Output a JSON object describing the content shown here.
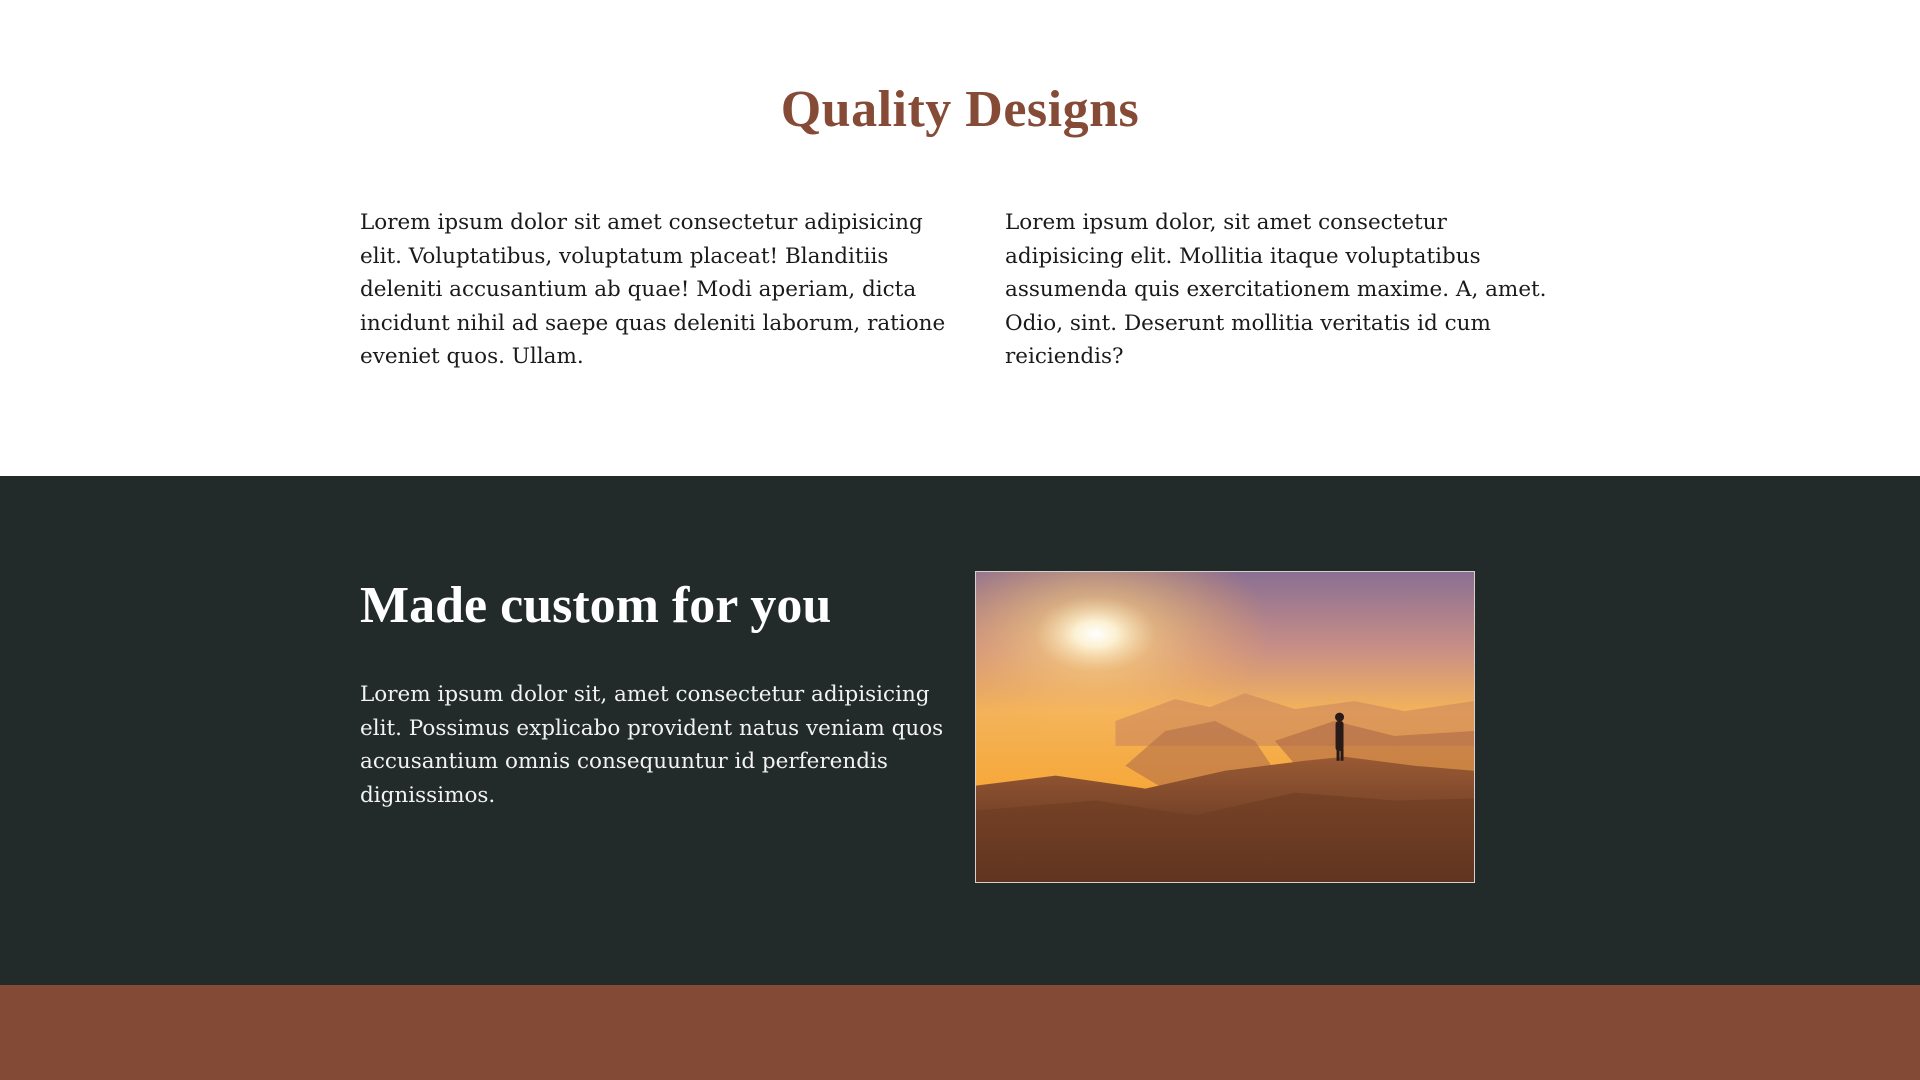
{
  "quality": {
    "title": "Quality Designs",
    "paragraph_left": "Lorem ipsum dolor sit amet consectetur adipisicing elit. Voluptatibus, voluptatum placeat! Blanditiis deleniti accusantium ab quae! Modi aperiam, dicta incidunt nihil ad saepe quas deleniti laborum, ratione eveniet quos. Ullam.",
    "paragraph_right": "Lorem ipsum dolor, sit amet consectetur adipisicing elit. Mollitia itaque voluptatibus assumenda quis exercitationem maxime. A, amet. Odio, sint. Deserunt mollitia veritatis id cum reiciendis?"
  },
  "custom": {
    "title": "Made custom for you",
    "paragraph": "Lorem ipsum dolor sit, amet consectetur adipisicing elit. Possimus explicabo provident natus veniam quos accusantium omnis consequuntur id perferendis dignissimos."
  },
  "colors": {
    "accent": "#864b36",
    "dark_section": "#222b2a",
    "band": "#834a36"
  }
}
